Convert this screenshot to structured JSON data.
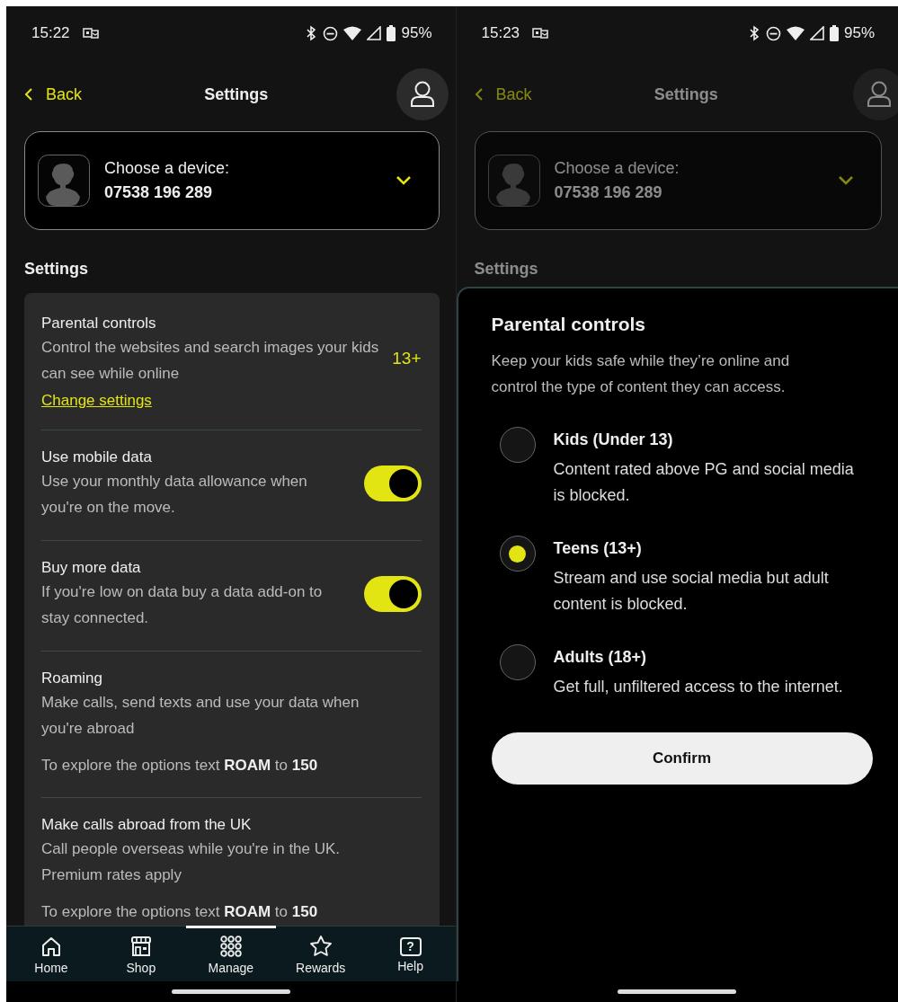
{
  "screens": [
    {
      "status_bar": {
        "time": "15:22",
        "battery": "95%"
      },
      "header": {
        "back": "Back",
        "title": "Settings"
      },
      "device": {
        "label": "Choose a device:",
        "number": "07538 196 289"
      },
      "section_title": "Settings",
      "settings": [
        {
          "kind": "link",
          "title": "Parental controls",
          "description": "Control the websites and search images your kids can see while online",
          "value": "13+",
          "link": "Change settings"
        },
        {
          "kind": "toggle",
          "title": "Use mobile data",
          "description": "Use your monthly data allowance when you're on the move.",
          "on": true
        },
        {
          "kind": "toggle",
          "title": "Buy more data",
          "description": "If you're low on data buy a data add-on to stay connected.",
          "on": true
        },
        {
          "kind": "info",
          "title": "Roaming",
          "description": "Make calls, send texts and use your data when you're abroad",
          "note": "To explore the options text **ROAM** to **150**"
        },
        {
          "kind": "info",
          "title": "Make calls abroad from the UK",
          "description": "Call people overseas while you're in the UK. Premium rates apply",
          "note": "To explore the options text **ROAM** to **150**"
        }
      ],
      "nav": [
        {
          "label": "Home",
          "selected": false
        },
        {
          "label": "Shop",
          "selected": false
        },
        {
          "label": "Manage",
          "selected": true
        },
        {
          "label": "Rewards",
          "selected": false
        },
        {
          "label": "Help",
          "selected": false,
          "icon_glyph": "?"
        }
      ]
    },
    {
      "status_bar": {
        "time": "15:23",
        "battery": "95%"
      },
      "dimmed": true,
      "header": {
        "back": "Back",
        "title": "Settings"
      },
      "device": {
        "label": "Choose a device:",
        "number": "07538 196 289"
      },
      "section_title": "Settings",
      "sheet": {
        "title": "Parental controls",
        "description": "Keep your kids safe while they’re online and control the type of content they can access.",
        "options": [
          {
            "title": "Kids (Under 13)",
            "description": "Content rated above PG and social media is blocked.",
            "selected": false
          },
          {
            "title": "Teens (13+)",
            "description": "Stream and use social media but adult content is blocked.",
            "selected": true
          },
          {
            "title": "Adults (18+)",
            "description": "Get full, unfiltered access to the internet.",
            "selected": false
          }
        ],
        "button": "Confirm"
      }
    }
  ]
}
